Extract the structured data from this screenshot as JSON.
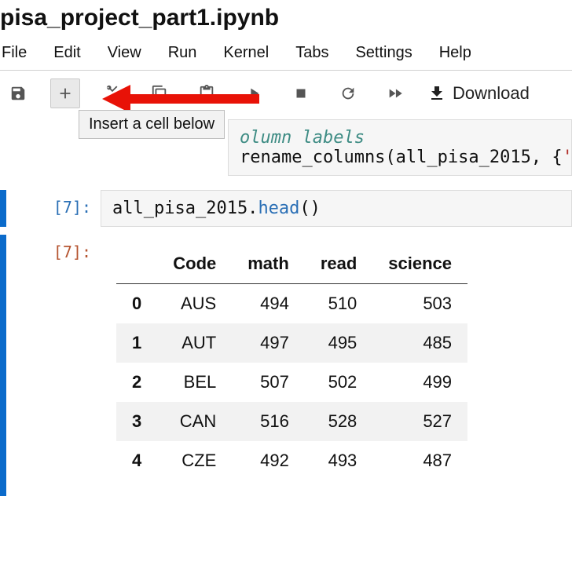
{
  "title": "pisa_project_part1.ipynb",
  "menu": [
    "File",
    "Edit",
    "View",
    "Run",
    "Kernel",
    "Tabs",
    "Settings",
    "Help"
  ],
  "tooltip": "Insert a cell below",
  "download_label": "Download",
  "cell_top": {
    "comment": "olumn labels",
    "code_prefix": "rename_columns(all_pisa_2015, {",
    "code_string": "'test"
  },
  "cell_in": {
    "prompt": "[7]:",
    "code_obj": "all_pisa_2015.",
    "code_method": "head",
    "code_tail": "()"
  },
  "cell_out": {
    "prompt": "[7]:",
    "columns": [
      "",
      "Code",
      "math",
      "read",
      "science"
    ],
    "rows": [
      {
        "idx": "0",
        "Code": "AUS",
        "math": "494",
        "read": "510",
        "science": "503"
      },
      {
        "idx": "1",
        "Code": "AUT",
        "math": "497",
        "read": "495",
        "science": "485"
      },
      {
        "idx": "2",
        "Code": "BEL",
        "math": "507",
        "read": "502",
        "science": "499"
      },
      {
        "idx": "3",
        "Code": "CAN",
        "math": "516",
        "read": "528",
        "science": "527"
      },
      {
        "idx": "4",
        "Code": "CZE",
        "math": "492",
        "read": "493",
        "science": "487"
      }
    ]
  }
}
